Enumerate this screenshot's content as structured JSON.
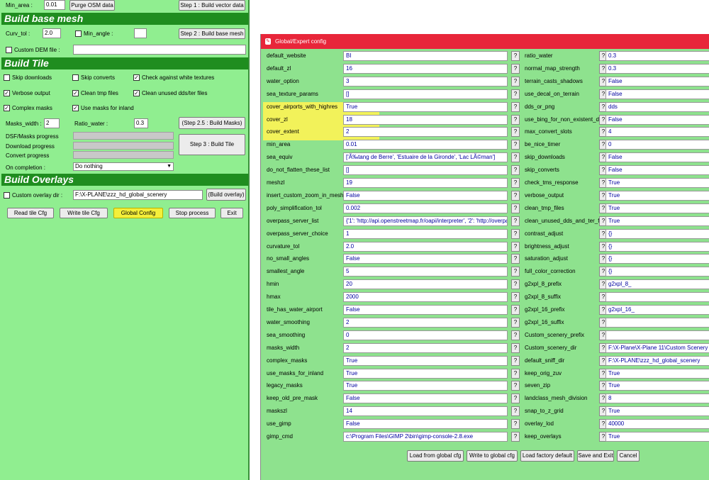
{
  "left": {
    "top": {
      "min_area_label": "Min_area :",
      "min_area_value": "0.01",
      "purge_btn": "Purge OSM data",
      "step1_btn": "Step 1 : Build vector data"
    },
    "base_mesh": {
      "title": "Build base mesh",
      "curv_tol_label": "Curv_tol :",
      "curv_tol_value": "2.0",
      "min_angle_label": "Min_angle :",
      "min_angle_value": "",
      "step2_btn": "Step 2 : Build base mesh",
      "custom_dem_label": "Custom DEM file :",
      "custom_dem_value": ""
    },
    "tile": {
      "title": "Build Tile",
      "checks": [
        {
          "label": "Skip downloads",
          "checked": false
        },
        {
          "label": "Skip converts",
          "checked": false
        },
        {
          "label": "Check against white textures",
          "checked": true
        },
        {
          "label": "Verbose output",
          "checked": true
        },
        {
          "label": "Clean tmp files",
          "checked": true
        },
        {
          "label": "Clean unused dds/ter files",
          "checked": true
        },
        {
          "label": "Complex masks",
          "checked": true
        },
        {
          "label": "Use masks for inland",
          "checked": true
        }
      ],
      "masks_width_label": "Masks_width :",
      "masks_width_value": "2",
      "ratio_water_label": "Ratio_water :",
      "ratio_water_value": "0.3",
      "step25_btn": "(Step 2.5 : Build Masks)",
      "dsf_progress_label": "DSF/Masks progress",
      "download_progress_label": "Download progress",
      "convert_progress_label": "Convert progress",
      "step3_btn": "Step 3 : Build Tile",
      "on_completion_label": "On completion :",
      "on_completion_value": "Do nothing"
    },
    "overlays": {
      "title": "Build Overlays",
      "custom_overlay_label": "Custom overlay dir :",
      "custom_overlay_value": "F:\\X-PLANE\\zzz_hd_global_scenery",
      "build_overlay_btn": "(Build overlay)"
    },
    "bottom_buttons": [
      "Read tile Cfg",
      "Write tile Cfg",
      "Global Config",
      "Stop process",
      "Exit"
    ]
  },
  "dialog": {
    "title": "Global/Expert config",
    "left_params": [
      {
        "name": "default_website",
        "value": "BI"
      },
      {
        "name": "default_zl",
        "value": "16"
      },
      {
        "name": "water_option",
        "value": "3"
      },
      {
        "name": "sea_texture_params",
        "value": "[]"
      },
      {
        "name": "cover_airports_with_highres",
        "value": "True"
      },
      {
        "name": "cover_zl",
        "value": "18"
      },
      {
        "name": "cover_extent",
        "value": "2"
      },
      {
        "name": "min_area",
        "value": "0.01"
      },
      {
        "name": "sea_equiv",
        "value": "['Ã‰tang de Berre', 'Estuaire de la Gironde', 'Lac LÃ©man']"
      },
      {
        "name": "do_not_flatten_these_list",
        "value": "[]"
      },
      {
        "name": "meshzl",
        "value": "19"
      },
      {
        "name": "insert_custom_zoom_in_mesh",
        "value": "False"
      },
      {
        "name": "poly_simplification_tol",
        "value": "0.002"
      },
      {
        "name": "overpass_server_list",
        "value": "{'1': 'http://api.openstreetmap.fr/oapi/interpreter', '2': 'http://overpass"
      },
      {
        "name": "overpass_server_choice",
        "value": "1"
      },
      {
        "name": "curvature_tol",
        "value": "2.0"
      },
      {
        "name": "no_small_angles",
        "value": "False"
      },
      {
        "name": "smallest_angle",
        "value": "5"
      },
      {
        "name": "hmin",
        "value": "20"
      },
      {
        "name": "hmax",
        "value": "2000"
      },
      {
        "name": "tile_has_water_airport",
        "value": "False"
      },
      {
        "name": "water_smoothing",
        "value": "2"
      },
      {
        "name": "sea_smoothing",
        "value": "0"
      },
      {
        "name": "masks_width",
        "value": "2"
      },
      {
        "name": "complex_masks",
        "value": "True"
      },
      {
        "name": "use_masks_for_inland",
        "value": "True"
      },
      {
        "name": "legacy_masks",
        "value": "True"
      },
      {
        "name": "keep_old_pre_mask",
        "value": "False"
      },
      {
        "name": "maskszl",
        "value": "14"
      },
      {
        "name": "use_gimp",
        "value": "False"
      },
      {
        "name": "gimp_cmd",
        "value": "c:\\Program Files\\GIMP 2\\bin\\gimp-console-2.8.exe"
      }
    ],
    "right_params": [
      {
        "name": "ratio_water",
        "value": "0.3"
      },
      {
        "name": "normal_map_strength",
        "value": "0.3"
      },
      {
        "name": "terrain_casts_shadows",
        "value": "False"
      },
      {
        "name": "use_decal_on_terrain",
        "value": "False"
      },
      {
        "name": "dds_or_png",
        "value": "dds"
      },
      {
        "name": "use_bing_for_non_existent_data",
        "value": "False"
      },
      {
        "name": "max_convert_slots",
        "value": "4"
      },
      {
        "name": "be_nice_timer",
        "value": "0"
      },
      {
        "name": "skip_downloads",
        "value": "False"
      },
      {
        "name": "skip_converts",
        "value": "False"
      },
      {
        "name": "check_tms_response",
        "value": "True"
      },
      {
        "name": "verbose_output",
        "value": "True"
      },
      {
        "name": "clean_tmp_files",
        "value": "True"
      },
      {
        "name": "clean_unused_dds_and_ter_files",
        "value": "True"
      },
      {
        "name": "contrast_adjust",
        "value": "{}"
      },
      {
        "name": "brightness_adjust",
        "value": "{}"
      },
      {
        "name": "saturation_adjust",
        "value": "{}"
      },
      {
        "name": "full_color_correction",
        "value": "{}"
      },
      {
        "name": "g2xpl_8_prefix",
        "value": "g2xpl_8_"
      },
      {
        "name": "g2xpl_8_suffix",
        "value": ""
      },
      {
        "name": "g2xpl_16_prefix",
        "value": "g2xpl_16_"
      },
      {
        "name": "g2xpl_16_suffix",
        "value": ""
      },
      {
        "name": "Custom_scenery_prefix",
        "value": ""
      },
      {
        "name": "Custom_scenery_dir",
        "value": "F:\\X-Plane\\X-Plane 11\\Custom Scenery"
      },
      {
        "name": "default_sniff_dir",
        "value": "F:\\X-PLANE\\zzz_hd_global_scenery"
      },
      {
        "name": "keep_orig_zuv",
        "value": "True"
      },
      {
        "name": "seven_zip",
        "value": "True"
      },
      {
        "name": "landclass_mesh_division",
        "value": "8"
      },
      {
        "name": "snap_to_z_grid",
        "value": "True"
      },
      {
        "name": "overlay_lod",
        "value": "40000"
      },
      {
        "name": "keep_overlays",
        "value": "True"
      }
    ],
    "help_label": "?",
    "buttons": [
      "Load from global cfg",
      "Write to global cfg",
      "Load factory default",
      "Save and Exit",
      "Cancel"
    ]
  },
  "colors": {
    "panel_bg": "#90ee90",
    "section_bg": "#1f8d1f",
    "title_bar": "#e8263a",
    "highlight": "#f2f25a"
  }
}
